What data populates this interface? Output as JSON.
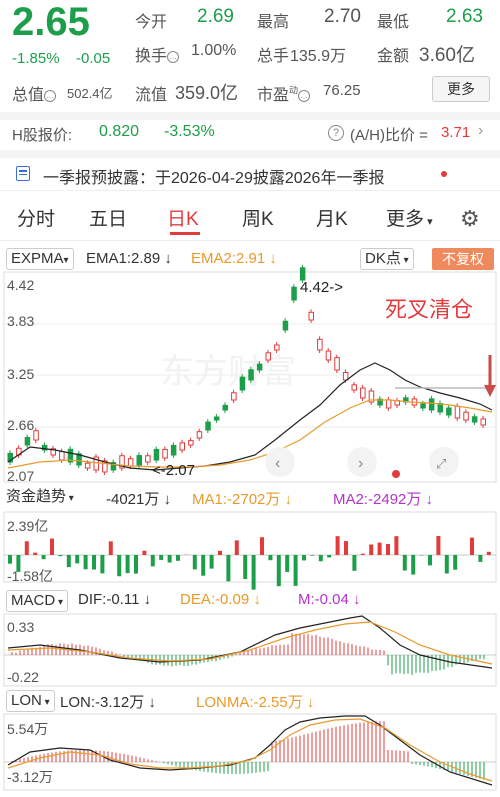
{
  "quote": {
    "price": "2.65",
    "change_pct": "-1.85%",
    "change": "-0.05",
    "open_label": "今开",
    "open": "2.69",
    "high_label": "最高",
    "high": "2.70",
    "low_label": "最低",
    "low": "2.63",
    "turnover_label": "换手",
    "turnover": "1.00%",
    "volume_label": "总手",
    "volume": "135.9万",
    "amount_label": "金额",
    "amount": "3.60亿",
    "mcap_label": "总值",
    "mcap": "502.4亿",
    "float_label": "流值",
    "float": "359.0亿",
    "pe_label": "市盈",
    "pe_sup": "动",
    "pe": "76.25",
    "more": "更多"
  },
  "hshare": {
    "label": "H股报价:",
    "price": "0.820",
    "pct": "-3.53%",
    "ah_label": "(A/H)比价 = ",
    "ah": "3.71"
  },
  "notice": {
    "text": "一季报预披露：于2026-04-29披露2026年一季报"
  },
  "tabs": [
    "分时",
    "五日",
    "日K",
    "周K",
    "月K",
    "更多"
  ],
  "kline": {
    "indicator": "EXPMA",
    "ema1": "EMA1:2.89",
    "ema2": "EMA2:2.91",
    "dk": "DK点",
    "fq": "不复权",
    "axis": [
      "4.42",
      "3.83",
      "3.25",
      "2.66",
      "2.07"
    ],
    "max_label": "4.42->",
    "min_label": "<-2.07",
    "annotation": "死叉清仓",
    "watermark": "东方财富"
  },
  "fund": {
    "name": "资金趋势",
    "value": "-4021万",
    "ma1": "MA1:-2702万",
    "ma2": "MA2:-2492万",
    "axis_top": "2.39亿",
    "axis_bot": "-1.58亿"
  },
  "macd": {
    "name": "MACD",
    "dif": "DIF:-0.11",
    "dea": "DEA:-0.09",
    "m": "M:-0.04",
    "axis_top": "0.33",
    "axis_bot": "-0.22"
  },
  "lon": {
    "name": "LON",
    "lon": "LON:-3.12万",
    "lonma": "LONMA:-2.55万",
    "axis_top": "5.54万",
    "axis_bot": "-3.12万"
  },
  "colors": {
    "up": "#e23b3b",
    "down": "#1d9e4a",
    "ema2": "#e89a2c",
    "purple": "#b035c9"
  }
}
